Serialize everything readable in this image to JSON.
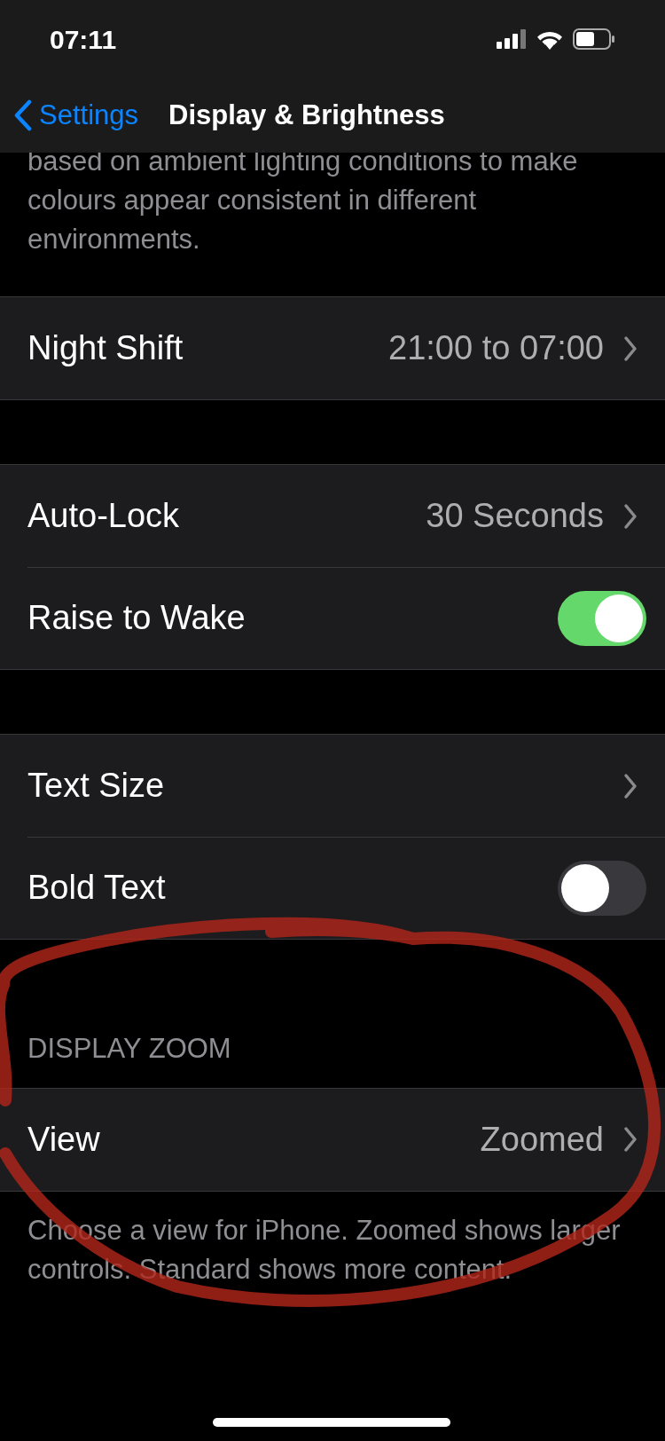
{
  "status_bar": {
    "time": "07:11"
  },
  "nav": {
    "back": "Settings",
    "title": "Display & Brightness"
  },
  "intro_text": "based on ambient lighting conditions to make colours appear consistent in different environments.",
  "groups": [
    {
      "rows": [
        {
          "kind": "link",
          "label": "Night Shift",
          "value": "21:00 to 07:00"
        }
      ]
    },
    {
      "rows": [
        {
          "kind": "link",
          "label": "Auto-Lock",
          "value": "30 Seconds"
        },
        {
          "kind": "toggle",
          "label": "Raise to Wake",
          "on": true
        }
      ]
    },
    {
      "rows": [
        {
          "kind": "link",
          "label": "Text Size"
        },
        {
          "kind": "toggle",
          "label": "Bold Text",
          "on": false
        }
      ]
    },
    {
      "header": "DISPLAY ZOOM",
      "rows": [
        {
          "kind": "link",
          "label": "View",
          "value": "Zoomed"
        }
      ],
      "footer": "Choose a view for iPhone. Zoomed shows larger controls. Standard shows more content."
    }
  ],
  "annotation": {
    "kind": "circle"
  }
}
